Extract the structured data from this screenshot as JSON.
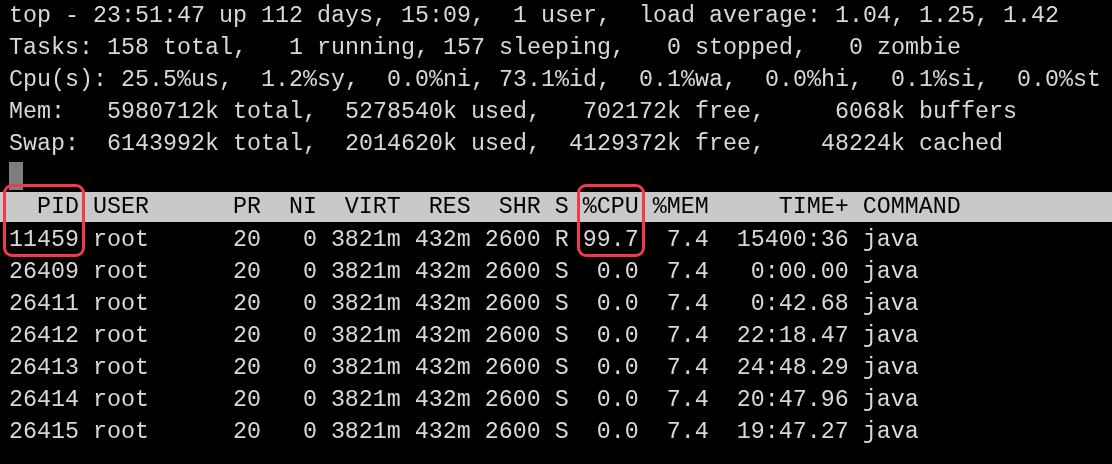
{
  "summary_lines": [
    "top - 23:51:47 up 112 days, 15:09,  1 user,  load average: 1.04, 1.25, 1.42",
    "Tasks: 158 total,   1 running, 157 sleeping,   0 stopped,   0 zombie",
    "Cpu(s): 25.5%us,  1.2%sy,  0.0%ni, 73.1%id,  0.1%wa,  0.0%hi,  0.1%si,  0.0%st",
    "Mem:   5980712k total,  5278540k used,   702172k free,     6068k buffers",
    "Swap:  6143992k total,  2014620k used,  4129372k free,    48224k cached"
  ],
  "table": {
    "columns": [
      {
        "label": "PID",
        "highlighted": true
      },
      {
        "label": "USER",
        "highlighted": false
      },
      {
        "label": "PR",
        "highlighted": false
      },
      {
        "label": "NI",
        "highlighted": false
      },
      {
        "label": "VIRT",
        "highlighted": false
      },
      {
        "label": "RES",
        "highlighted": false
      },
      {
        "label": "SHR",
        "highlighted": false
      },
      {
        "label": "S",
        "highlighted": false
      },
      {
        "label": "%CPU",
        "highlighted": true
      },
      {
        "label": "%MEM",
        "highlighted": false
      },
      {
        "label": "TIME+",
        "highlighted": false
      },
      {
        "label": "COMMAND",
        "highlighted": false
      }
    ],
    "rows": [
      [
        "11459",
        "root",
        "20",
        "0",
        "3821m",
        "432m",
        "2600",
        "R",
        "99.7",
        "7.4",
        "15400:36",
        "java"
      ],
      [
        "26409",
        "root",
        "20",
        "0",
        "3821m",
        "432m",
        "2600",
        "S",
        "0.0",
        "7.4",
        "0:00.00",
        "java"
      ],
      [
        "26411",
        "root",
        "20",
        "0",
        "3821m",
        "432m",
        "2600",
        "S",
        "0.0",
        "7.4",
        "0:42.68",
        "java"
      ],
      [
        "26412",
        "root",
        "20",
        "0",
        "3821m",
        "432m",
        "2600",
        "S",
        "0.0",
        "7.4",
        "22:18.47",
        "java"
      ],
      [
        "26413",
        "root",
        "20",
        "0",
        "3821m",
        "432m",
        "2600",
        "S",
        "0.0",
        "7.4",
        "24:48.29",
        "java"
      ],
      [
        "26414",
        "root",
        "20",
        "0",
        "3821m",
        "432m",
        "2600",
        "S",
        "0.0",
        "7.4",
        "20:47.96",
        "java"
      ],
      [
        "26415",
        "root",
        "20",
        "0",
        "3821m",
        "432m",
        "2600",
        "S",
        "0.0",
        "7.4",
        "19:47.27",
        "java"
      ]
    ]
  }
}
